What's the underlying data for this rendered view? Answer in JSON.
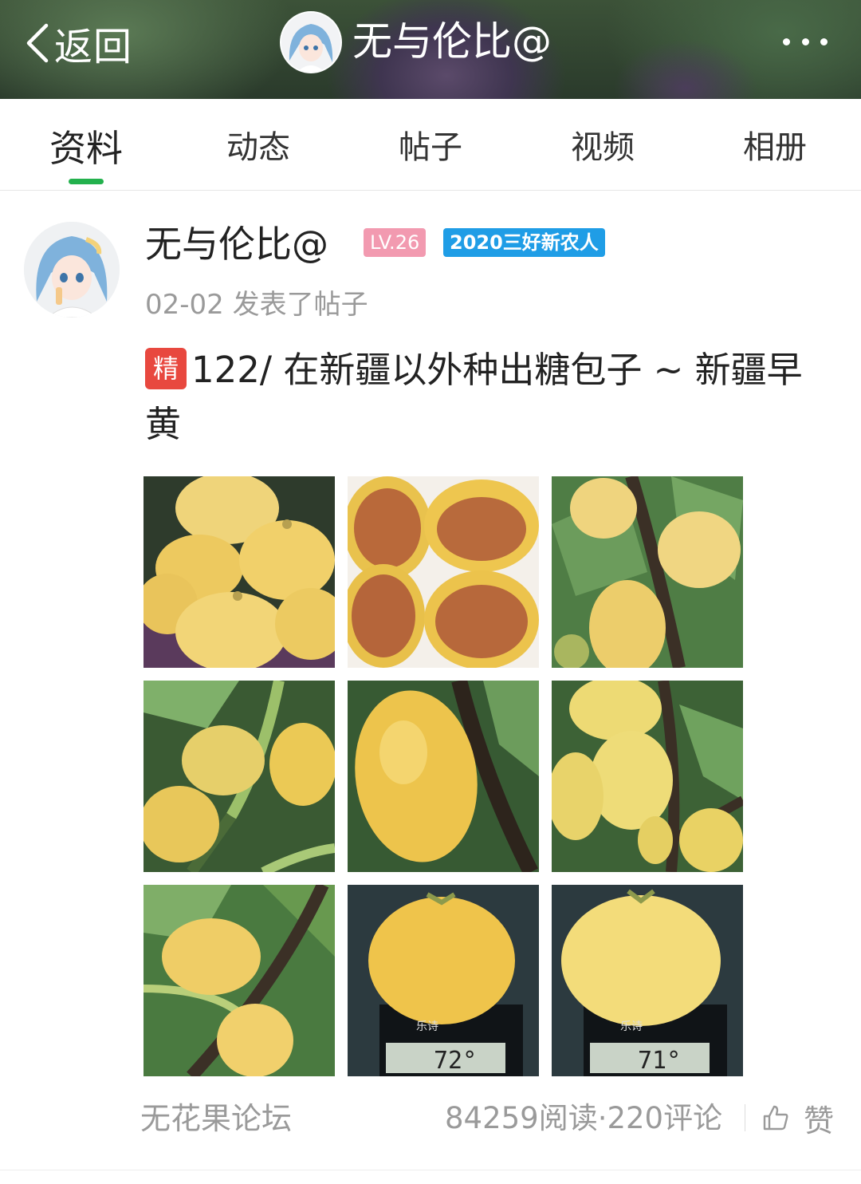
{
  "header": {
    "back_label": "返回",
    "username": "无与伦比@"
  },
  "tabs": [
    {
      "label": "资料",
      "active": true
    },
    {
      "label": "动态",
      "active": false
    },
    {
      "label": "帖子",
      "active": false
    },
    {
      "label": "视频",
      "active": false
    },
    {
      "label": "相册",
      "active": false
    }
  ],
  "post": {
    "author": "无与伦比@",
    "level_badge": "LV.26",
    "title_badge": "2020三好新农人",
    "date": "02-02",
    "action": "发表了帖子",
    "featured_tag": "精",
    "title": "122/ 在新疆以外种出糖包子 ~ 新疆早黄",
    "images": [
      {
        "desc": "yellow figs pile"
      },
      {
        "desc": "halved figs"
      },
      {
        "desc": "fig on branch"
      },
      {
        "desc": "figs on stem"
      },
      {
        "desc": "single fig closeup"
      },
      {
        "desc": "fig cluster"
      },
      {
        "desc": "fig on branch"
      },
      {
        "desc": "fig on scale"
      },
      {
        "desc": "fig on scale"
      }
    ],
    "scale_text": [
      "乐诗",
      "乐诗"
    ],
    "scale_readings": [
      "72°",
      "71°"
    ],
    "forum": "无花果论坛",
    "stats": "84259阅读·220评论",
    "like_label": "赞"
  },
  "colors": {
    "accent_green": "#23b14d",
    "level_pink": "#f29ab0",
    "badge_blue": "#1f9de6",
    "featured_red": "#e8483f"
  },
  "icons": [
    "back-chevron-icon",
    "more-dots-icon",
    "thumbs-up-icon"
  ]
}
